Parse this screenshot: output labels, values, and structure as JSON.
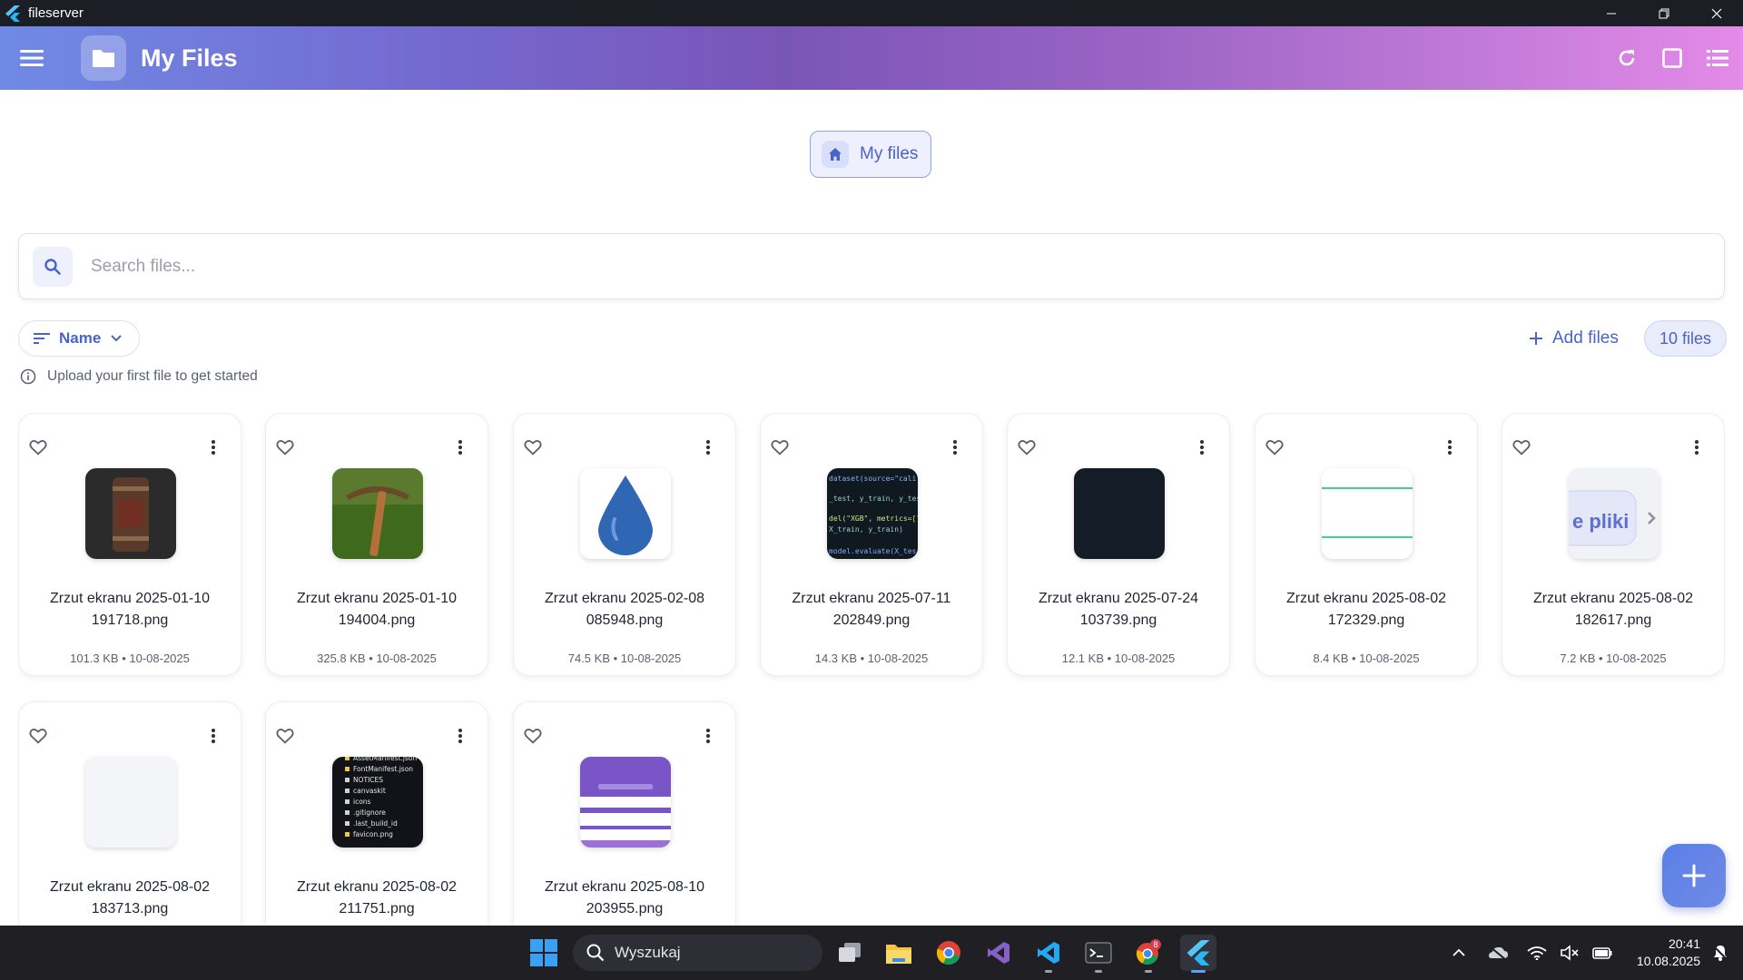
{
  "window": {
    "title": "fileserver"
  },
  "appbar": {
    "title": "My Files"
  },
  "breadcrumb": {
    "label": "My files"
  },
  "search": {
    "placeholder": "Search files..."
  },
  "toolbar": {
    "sort_label": "Name",
    "add_files_label": "Add files",
    "file_count_label": "10 files"
  },
  "hint": {
    "text": "Upload your first file to get started"
  },
  "files": [
    {
      "name_line1": "Zrzut ekranu 2025-01-10",
      "name_line2": "191718.png",
      "meta": "101.3 KB • 10-08-2025",
      "thumb": "barrel"
    },
    {
      "name_line1": "Zrzut ekranu 2025-01-10",
      "name_line2": "194004.png",
      "meta": "325.8 KB • 10-08-2025",
      "thumb": "pickaxe"
    },
    {
      "name_line1": "Zrzut ekranu 2025-02-08",
      "name_line2": "085948.png",
      "meta": "74.5 KB • 10-08-2025",
      "thumb": "drop"
    },
    {
      "name_line1": "Zrzut ekranu 2025-07-11",
      "name_line2": "202849.png",
      "meta": "14.3 KB • 10-08-2025",
      "thumb": "code"
    },
    {
      "name_line1": "Zrzut ekranu 2025-07-24",
      "name_line2": "103739.png",
      "meta": "12.1 KB • 10-08-2025",
      "thumb": "dark"
    },
    {
      "name_line1": "Zrzut ekranu 2025-08-02",
      "name_line2": "172329.png",
      "meta": "8.4 KB • 10-08-2025",
      "thumb": "lines"
    },
    {
      "name_line1": "Zrzut ekranu 2025-08-02",
      "name_line2": "182617.png",
      "meta": "7.2 KB • 10-08-2025",
      "thumb": "pliki",
      "thumb_text": "e pliki"
    },
    {
      "name_line1": "Zrzut ekranu 2025-08-02",
      "name_line2": "183713.png",
      "meta": "",
      "thumb": "blank"
    },
    {
      "name_line1": "Zrzut ekranu 2025-08-02",
      "name_line2": "211751.png",
      "meta": "",
      "thumb": "tree",
      "thumb_lines": [
        "AssetManifest.json",
        "FontManifest.json",
        "NOTICES",
        "canvaskit",
        "icons",
        ".gitignore",
        ".last_build_id",
        "favicon.png"
      ]
    },
    {
      "name_line1": "Zrzut ekranu 2025-08-10",
      "name_line2": "203955.png",
      "meta": "",
      "thumb": "login"
    }
  ],
  "taskbar": {
    "search_label": "Wyszukaj",
    "time": "20:41",
    "date": "10.08.2025",
    "badge": "8"
  },
  "colors": {
    "accent": "#4a63c7",
    "gradient_start": "#6f8ae6",
    "gradient_end": "#e48ae8"
  }
}
